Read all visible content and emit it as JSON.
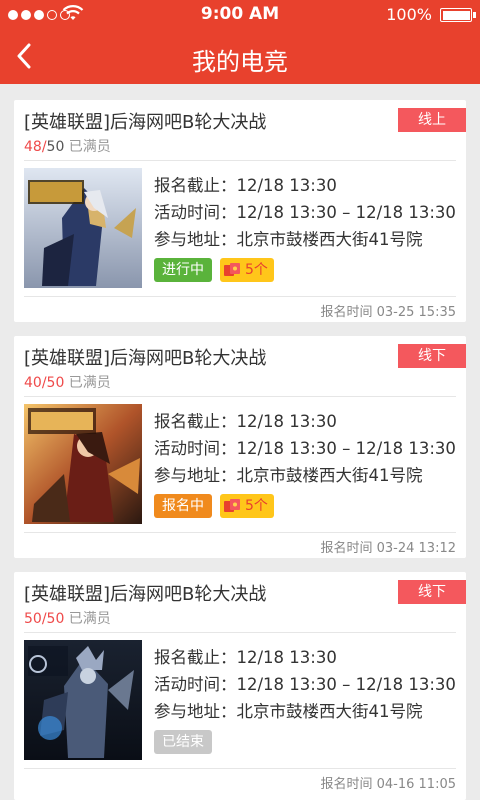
{
  "status_bar": {
    "time": "9:00 AM",
    "battery": "100%"
  },
  "header": {
    "title": "我的电竞"
  },
  "colors": {
    "accent": "#e8412d",
    "tag": "#f4585d",
    "in_progress": "#5ab33b",
    "registering": "#f08a1d",
    "ended": "#c8c8c8"
  },
  "cards": [
    {
      "title": "[英雄联盟]后海网吧B轮大决战",
      "tag": "线上",
      "members_current": "48/",
      "members_capacity": "50",
      "members_status": " 已满员",
      "deadline": "报名截止：12/18 13:30",
      "activity_time": "活动时间：12/18 13:30 – 12/18 13:30",
      "address": "参与地址：北京市鼓楼西大街41号院",
      "status": "进行中",
      "redpack": "5个",
      "signup_time": "报名时间   03-25 15:35"
    },
    {
      "title": "[英雄联盟]后海网吧B轮大决战",
      "tag": "线下",
      "members_current": "40/50",
      "members_capacity": "",
      "members_status": " 已满员",
      "deadline": "报名截止：12/18 13:30",
      "activity_time": "活动时间：12/18 13:30 – 12/18 13:30",
      "address": "参与地址：北京市鼓楼西大街41号院",
      "status": "报名中",
      "redpack": "5个",
      "signup_time": "报名时间   03-24 13:12"
    },
    {
      "title": "[英雄联盟]后海网吧B轮大决战",
      "tag": "线下",
      "members_current": "50/50",
      "members_capacity": "",
      "members_status": " 已满员",
      "deadline": "报名截止：12/18 13:30",
      "activity_time": "活动时间：12/18 13:30 – 12/18 13:30",
      "address": "参与地址：北京市鼓楼西大街41号院",
      "status": "已结束",
      "redpack": "",
      "signup_time": "报名时间   04-16 11:05"
    }
  ]
}
